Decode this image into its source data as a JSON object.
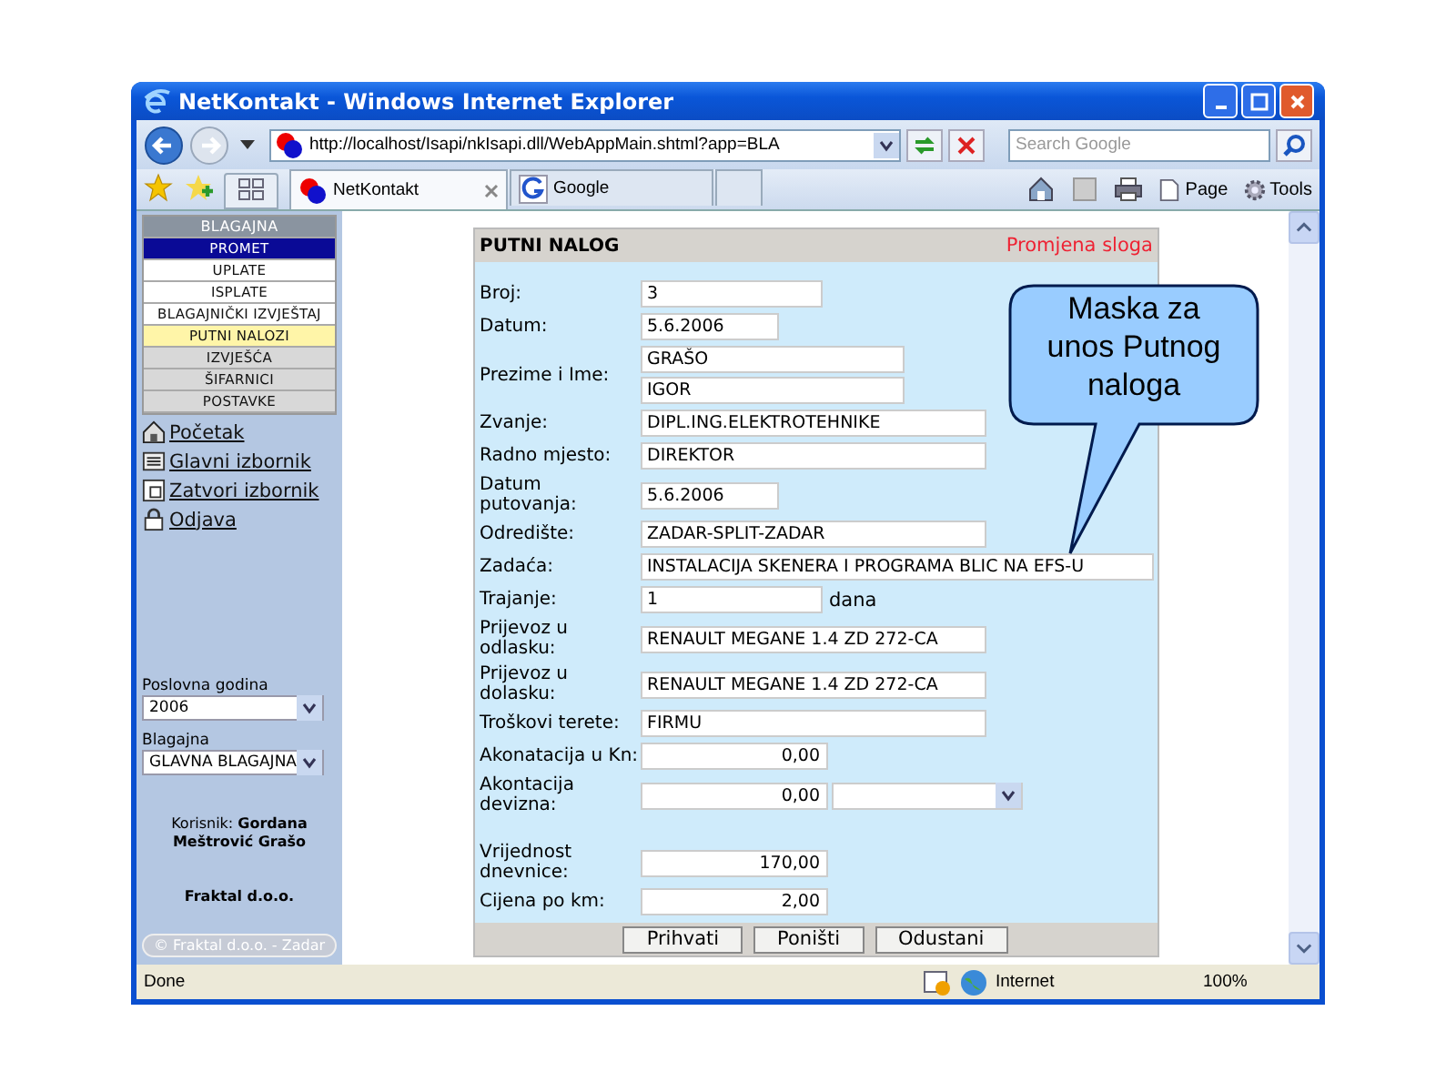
{
  "window": {
    "title": "NetKontakt - Windows Internet Explorer"
  },
  "address_bar": {
    "url": "http://localhost/Isapi/nkIsapi.dll/WebAppMain.shtml?app=BLA"
  },
  "search": {
    "placeholder": "Search Google"
  },
  "tabs": [
    {
      "label": "NetKontakt",
      "selected": true
    },
    {
      "label": "Google",
      "selected": false
    }
  ],
  "toolbar": {
    "buttons": [
      "Page",
      "Tools"
    ]
  },
  "sidebar": {
    "menu": [
      {
        "label": "BLAGAJNA",
        "kind": "header",
        "selected": false
      },
      {
        "label": "PROMET",
        "kind": "group",
        "selected": false
      },
      {
        "label": "UPLATE",
        "kind": "item",
        "selected": false
      },
      {
        "label": "ISPLATE",
        "kind": "item",
        "selected": false
      },
      {
        "label": "BLAGAJNIČKI IZVJEŠTAJ",
        "kind": "item",
        "selected": false
      },
      {
        "label": "PUTNI NALOZI",
        "kind": "item",
        "selected": true
      },
      {
        "label": "IZVJEŠĆA",
        "kind": "section",
        "selected": false
      },
      {
        "label": "ŠIFARNICI",
        "kind": "section",
        "selected": false
      },
      {
        "label": "POSTAVKE",
        "kind": "section",
        "selected": false
      }
    ],
    "links": [
      {
        "label": "Početak",
        "kind": "home"
      },
      {
        "label": "Glavni izbornik",
        "kind": "menu"
      },
      {
        "label": "Zatvori izbornik",
        "kind": "close"
      },
      {
        "label": "Odjava",
        "kind": "logout"
      }
    ],
    "selects": [
      {
        "label": "Poslovna godina",
        "value": "2006"
      },
      {
        "label": "Blagajna",
        "value": "GLAVNA BLAGAJNA"
      }
    ],
    "user": "Korisnik: **Gordana Meštrović Grašo**",
    "company": "Fraktal d.o.o.",
    "footer": "© Fraktal d.o.o. - Zadar"
  },
  "form": {
    "title": "PUTNI NALOG",
    "mode": "Promjena sloga",
    "fields": [
      {
        "label": "Broj:",
        "kind": "short",
        "value": "3"
      },
      {
        "label": "Datum:",
        "kind": "date",
        "value": "5.6.2006"
      },
      {
        "label": "Prezime i Ime:",
        "kind": "double",
        "values": [
          "GRAŠO",
          "IGOR"
        ]
      },
      {
        "label": "Zvanje:",
        "kind": "wide",
        "value": "DIPL.ING.ELEKTROTEHNIKE"
      },
      {
        "label": "Radno mjesto:",
        "kind": "wide",
        "value": "DIREKTOR"
      },
      {
        "label": "Datum putovanja:",
        "kind": "date",
        "value": "5.6.2006"
      },
      {
        "label": "Odredište:",
        "kind": "wide",
        "value": "ZADAR-SPLIT-ZADAR"
      },
      {
        "label": "Zadaća:",
        "kind": "widest",
        "value": "INSTALACIJA SKENERA I PROGRAMA BLIC NA EFS-U"
      },
      {
        "label": "Trajanje:",
        "kind": "short",
        "value": "1",
        "suffix": "dana"
      },
      {
        "label": "Prijevoz u odlasku:",
        "kind": "wide",
        "value": "RENAULT MEGANE 1.4 ZD 272-CA"
      },
      {
        "label": "Prijevoz u dolasku:",
        "kind": "wide",
        "value": "RENAULT MEGANE 1.4 ZD 272-CA"
      },
      {
        "label": "Troškovi terete:",
        "kind": "wide",
        "value": "FIRMU"
      },
      {
        "label": "Akonatacija u Kn:",
        "kind": "amount",
        "value": "0,00"
      },
      {
        "label": "Akontacija devizna:",
        "kind": "amount_select",
        "value": "0,00"
      },
      {
        "label": "Vrijednost dnevnice:",
        "kind": "amount",
        "value": "170,00"
      },
      {
        "label": "Cijena po km:",
        "kind": "amount",
        "value": "2,00"
      }
    ],
    "buttons": [
      "Prihvati",
      "Poništi",
      "Odustani"
    ]
  },
  "callout": {
    "text": "Maska za unos Putnog naloga"
  },
  "status_bar": {
    "text": "Done",
    "zone": "Internet",
    "zoom": "100%"
  }
}
